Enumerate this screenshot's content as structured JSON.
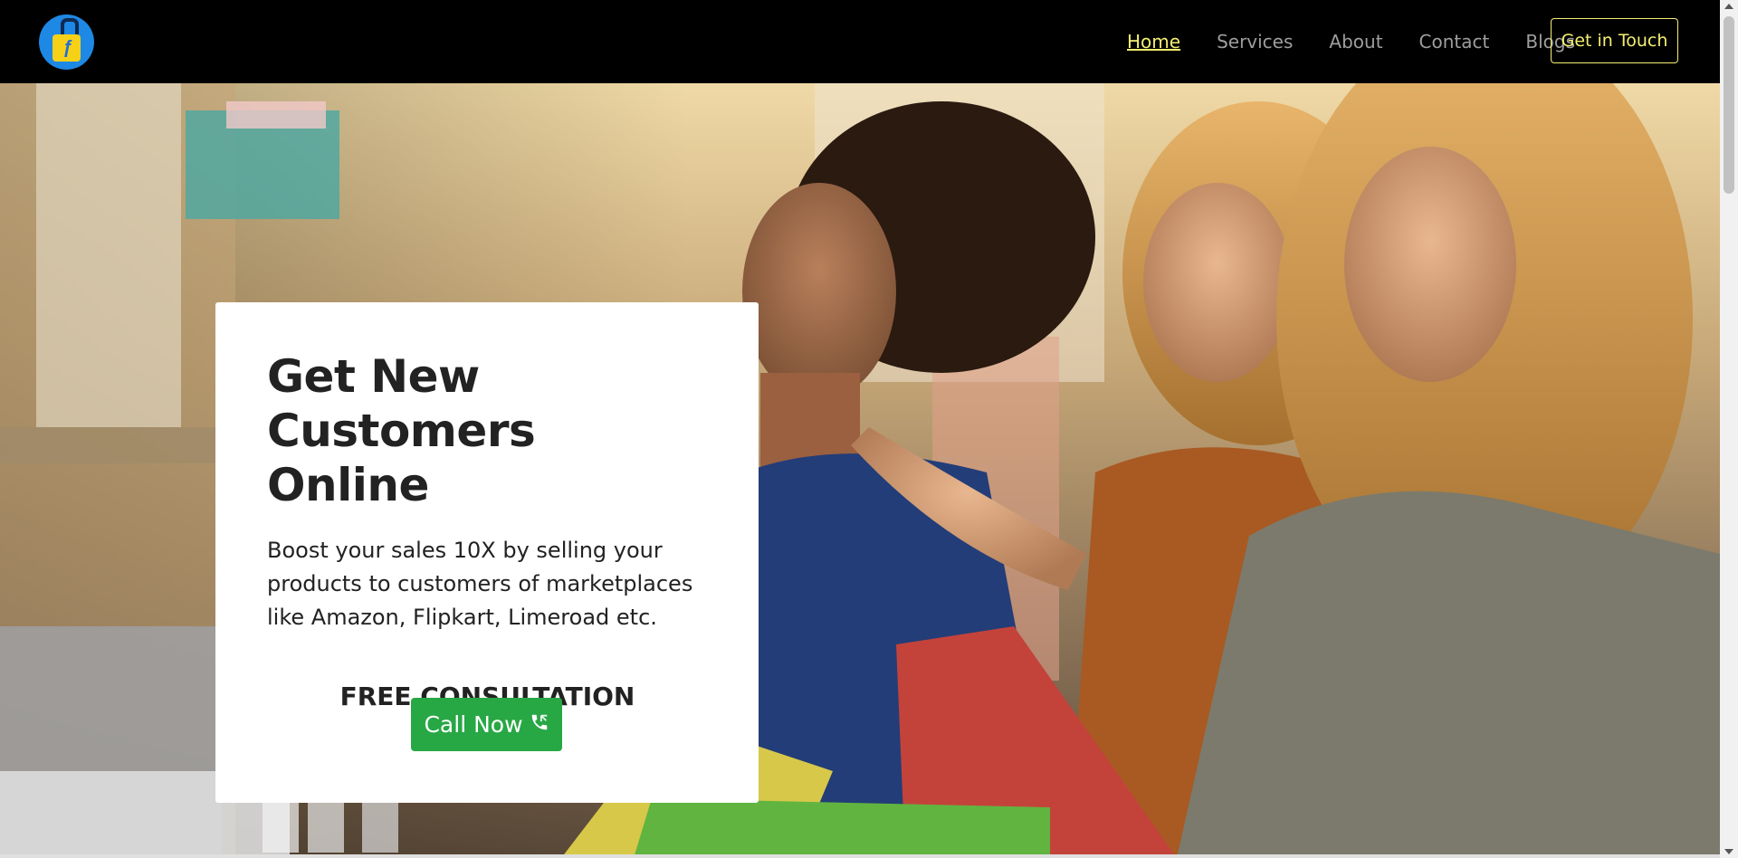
{
  "nav": {
    "items": [
      {
        "label": "Home",
        "active": true
      },
      {
        "label": "Services",
        "active": false
      },
      {
        "label": "About",
        "active": false
      },
      {
        "label": "Contact",
        "active": false
      },
      {
        "label": "Blogs",
        "active": false
      }
    ],
    "cta_label": "Get in Touch"
  },
  "hero": {
    "title": "Get New Customers Online",
    "lead": "Boost your sales 10X by selling your products to customers of marketplaces like Amazon, Flipkart, Limeroad etc.",
    "consultation": "FREE CONSULTATION",
    "call_label": "Call Now",
    "call_icon": "phone-icon"
  },
  "colors": {
    "nav_bg": "#000000",
    "nav_link": "#9e9e9e",
    "nav_active": "#f4ef70",
    "call_button": "#28a745"
  }
}
